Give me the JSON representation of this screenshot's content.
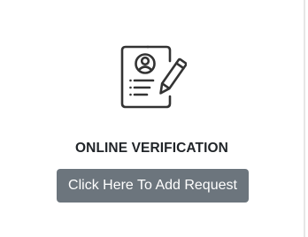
{
  "card": {
    "title": "ONLINE VERIFICATION",
    "button_label": "Click Here To Add Request",
    "icon": "document-profile-pen-icon"
  },
  "colors": {
    "button_bg": "#6c757d",
    "button_text": "#ffffff",
    "title_text": "#212529",
    "icon_stroke": "#333333"
  }
}
